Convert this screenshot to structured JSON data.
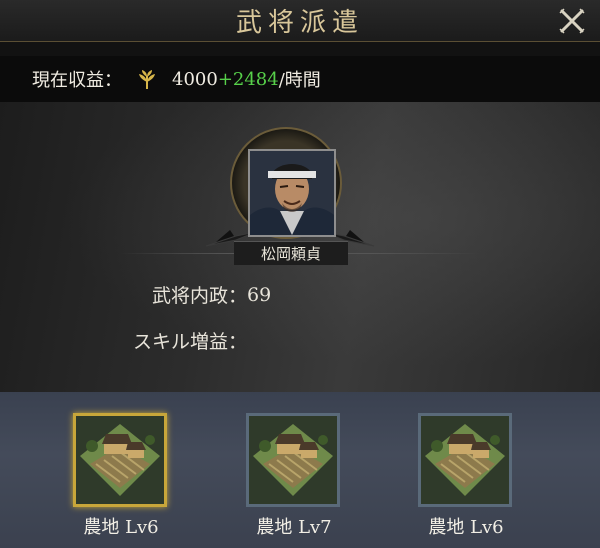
{
  "header": {
    "title": "武将派遣",
    "close_icon": "close-x-icon"
  },
  "income": {
    "label": "現在収益：",
    "icon": "wheat-icon",
    "base": "4000",
    "bonus": "+2484",
    "unit": "/時間",
    "bonus_color": "#57d04a"
  },
  "general": {
    "name": "松岡頼貞",
    "portrait": "samurai-portrait"
  },
  "stats": {
    "politics_label": "武将内政：",
    "politics_value": "69",
    "skill_label": "スキル増益：",
    "skill_value": ""
  },
  "farms": [
    {
      "label": "農地 Lv6",
      "selected": true
    },
    {
      "label": "農地 Lv7",
      "selected": false
    },
    {
      "label": "農地 Lv6",
      "selected": false
    }
  ],
  "colors": {
    "accent_gold": "#c8a63a",
    "title_text": "#d9c79a"
  }
}
